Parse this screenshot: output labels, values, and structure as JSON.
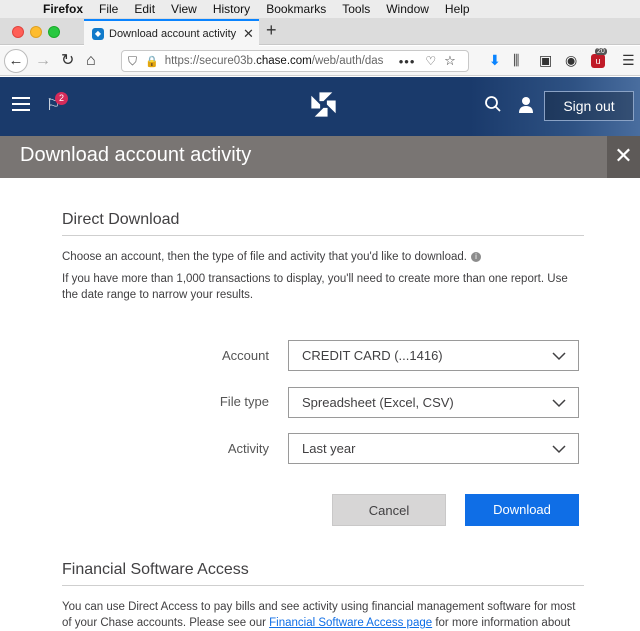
{
  "menubar": {
    "app": "Firefox",
    "items": [
      "File",
      "Edit",
      "View",
      "History",
      "Bookmarks",
      "Tools",
      "Window",
      "Help"
    ]
  },
  "browser": {
    "tab_title": "Download account activity - ch",
    "url_prefix": "https://secure03b.",
    "url_domain": "chase.com",
    "url_suffix": "/web/auth/das",
    "extension_badge": "20",
    "accent_color": "#0a84ff"
  },
  "header": {
    "notification_count": "2",
    "sign_out_label": "Sign out",
    "brand_color": "#1a3a6b"
  },
  "page": {
    "title": "Download account activity"
  },
  "direct_download": {
    "heading": "Direct Download",
    "instruction": "Choose an account, then the type of file and activity that you'd like to download.",
    "note": "If you have more than 1,000 transactions to display, you'll need to create more than one report. Use the date range to narrow your results."
  },
  "form": {
    "account_label": "Account",
    "account_value": "CREDIT CARD (...1416)",
    "filetype_label": "File type",
    "filetype_value": "Spreadsheet (Excel, CSV)",
    "activity_label": "Activity",
    "activity_value": "Last year",
    "cancel_label": "Cancel",
    "download_label": "Download"
  },
  "financial_software": {
    "heading": "Financial Software Access",
    "text_before": "You can use Direct Access to pay bills and see activity using financial management software for most of your Chase accounts. Please see our ",
    "link": "Financial Software Access page",
    "text_after": " for more information about"
  }
}
